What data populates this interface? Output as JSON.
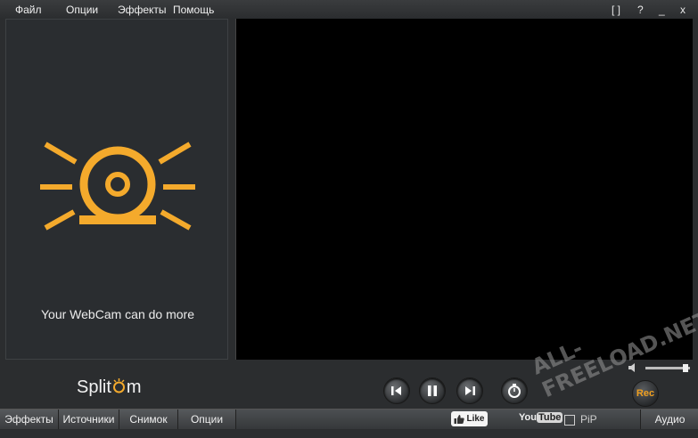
{
  "menu": {
    "file": "Файл",
    "options": "Опции",
    "effects": "Эффекты",
    "help": "Помощь"
  },
  "window_controls": {
    "fullscreen": "[ ]",
    "help": "?",
    "minimize": "_",
    "close": "x"
  },
  "left_panel": {
    "tagline": "Your WebCam can do more",
    "icon": "webcam-icon",
    "accent_color": "#f4aa2c"
  },
  "logo": {
    "prefix": "Split",
    "suffix": "m"
  },
  "controls": {
    "prev": "prev-icon",
    "pause": "pause-icon",
    "next": "next-icon",
    "timer": "timer-icon",
    "rec": "Rec"
  },
  "volume_level": 0.9,
  "bottom_tabs": [
    "Эффекты",
    "Источники",
    "Снимок",
    "Опции"
  ],
  "like_label": "Like",
  "youtube": {
    "you": "You",
    "tube": "Tube"
  },
  "pip_label": "PiP",
  "audio_label": "Аудио",
  "watermark": "ALL-FREELOAD.NET"
}
